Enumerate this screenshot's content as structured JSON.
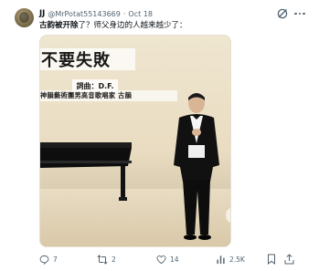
{
  "tweet": {
    "display_name": "JJ",
    "handle": "@MrPotat55143669",
    "separator": "·",
    "time": "Oct 18",
    "text_bold": "古韵被开除",
    "text_rest": "了？师父身边的人越来越少了："
  },
  "media": {
    "title": "不要失敗",
    "lyric_credit": "詞曲：D.F.",
    "singer_credit": "神韻藝術團男高音歌唱家 古韻"
  },
  "actions": {
    "replies": "7",
    "reposts": "2",
    "likes": "14",
    "views": "2.5K"
  },
  "colors": {
    "text": "#0f1419",
    "secondary": "#536471"
  },
  "icons": [
    "grok-icon",
    "more-icon",
    "reply-icon",
    "repost-icon",
    "like-icon",
    "views-icon",
    "bookmark-icon",
    "share-icon"
  ]
}
